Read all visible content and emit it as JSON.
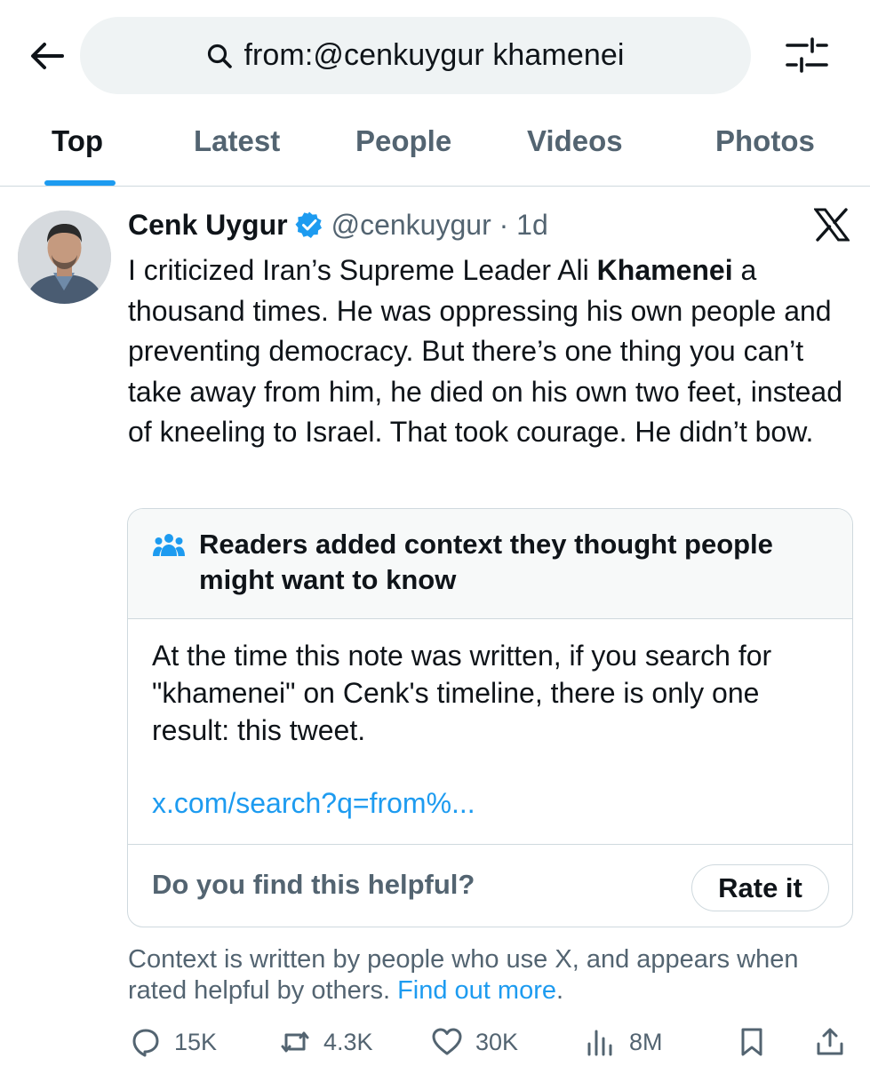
{
  "search": {
    "query": "from:@cenkuygur khamenei"
  },
  "tabs": [
    {
      "label": "Top",
      "active": true
    },
    {
      "label": "Latest",
      "active": false
    },
    {
      "label": "People",
      "active": false
    },
    {
      "label": "Videos",
      "active": false
    },
    {
      "label": "Photos",
      "active": false
    }
  ],
  "tweet": {
    "author_name": "Cenk Uygur",
    "handle_time": "@cenkuygur · 1d",
    "text_before": "I criticized Iran’s Supreme Leader Ali ",
    "text_bold": "Khamenei",
    "text_after": " a thousand times. He was oppressing his own people and preventing democracy. But there’s one thing you can’t take away from him, he died on his own two feet, instead of kneeling to Israel. That took courage. He didn’t bow."
  },
  "note": {
    "title": "Readers added context they thought people might want to know",
    "body": "At the time this note was written, if you search for \"khamenei\" on Cenk's timeline, there is only one result: this tweet.",
    "link": "x.com/search?q=from%...",
    "helpful_question": "Do you find this helpful?",
    "rate_label": "Rate it"
  },
  "context": {
    "text": "Context is written by people who use X, and appears when rated helpful by others. ",
    "link": "Find out more",
    "end": "."
  },
  "actions": {
    "replies": "15K",
    "reposts": "4.3K",
    "likes": "30K",
    "views": "8M"
  },
  "colors": {
    "accent": "#1d9bf0",
    "secondary_text": "#536471",
    "border": "#cfd9de",
    "search_bg": "#eff3f4"
  }
}
